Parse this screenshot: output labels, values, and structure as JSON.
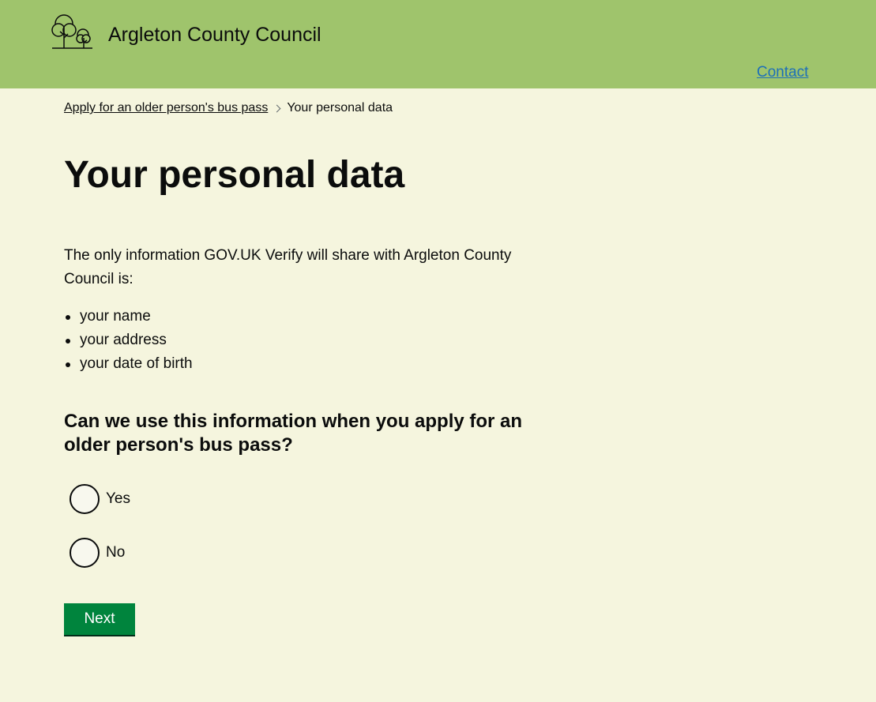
{
  "header": {
    "logo_icon": "trees-icon",
    "org_name": "Argleton County Council",
    "contact_label": "Contact",
    "background_color": "#9fc46c"
  },
  "breadcrumb": {
    "items": [
      {
        "label": "Apply for an older person's bus pass",
        "link": true
      },
      {
        "label": "Your personal data",
        "link": false
      }
    ]
  },
  "main": {
    "title": "Your personal data",
    "intro": "The only information GOV.UK Verify will share with Argleton County Council is:",
    "list": [
      "your name",
      "your address",
      "your date of birth"
    ],
    "question": "Can we use this information when you apply for an older person's bus pass?",
    "options": [
      {
        "label": "Yes",
        "selected": false
      },
      {
        "label": "No",
        "selected": false
      }
    ],
    "next_label": "Next"
  },
  "colors": {
    "page_background": "#f5f5de",
    "button": "#00843d",
    "link": "#1d70b8"
  }
}
